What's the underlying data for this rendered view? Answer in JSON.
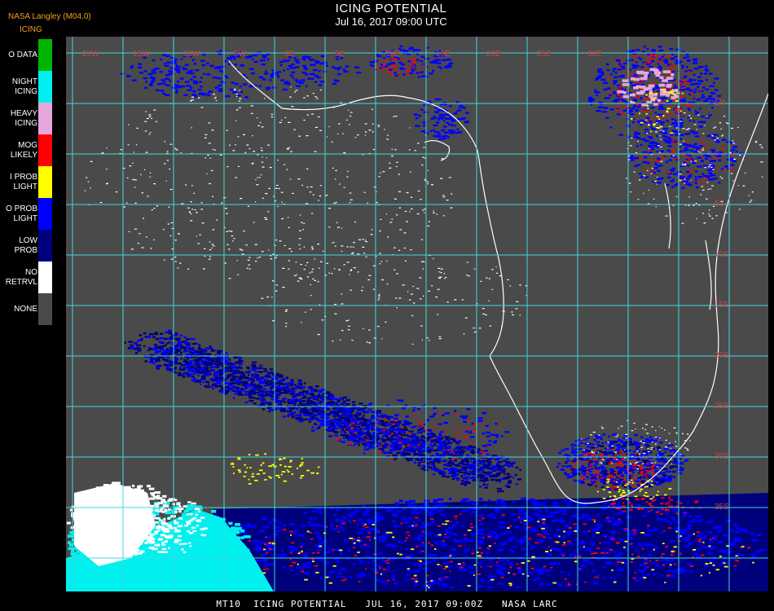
{
  "header": {
    "organization": "NASA Langley (M04.0)",
    "title": "ICING POTENTIAL",
    "datetime": "Jul 16, 2017 09:00 UTC",
    "product": "ICING"
  },
  "legend": {
    "items": [
      {
        "label": "O DATA",
        "color": "#00b400"
      },
      {
        "label": "NIGHT\nICING",
        "color": "#00f0f0"
      },
      {
        "label": "HEAVY\nICING",
        "color": "#e6a6dc"
      },
      {
        "label": "MOG\nLIKELY",
        "color": "#ff0000"
      },
      {
        "label": "I PROB\nLIGHT",
        "color": "#ffff00"
      },
      {
        "label": "O PROB\nLIGHT",
        "color": "#0000ff"
      },
      {
        "label": "LOW\nPROB",
        "color": "#00007d"
      },
      {
        "label": "NO\nRETRVL",
        "color": "#ffffff"
      },
      {
        "label": "NONE",
        "color": "#4a4a4a"
      }
    ]
  },
  "map": {
    "grid_color": "#40d8e0",
    "coast_color": "#ffffff",
    "label_color": "#d04040",
    "lon_labels": [
      "20W",
      "15W",
      "10W",
      "5W",
      "0E",
      "5E",
      "10E",
      "15E",
      "20E",
      "25E",
      "30E"
    ],
    "lat_labels": [
      "5N",
      "0",
      "5S",
      "10S",
      "15S",
      "20S",
      "25S",
      "30S",
      "35S"
    ]
  },
  "footer": "MT10  ICING POTENTIAL   JUL 16, 2017 09:00Z   NASA LARC"
}
